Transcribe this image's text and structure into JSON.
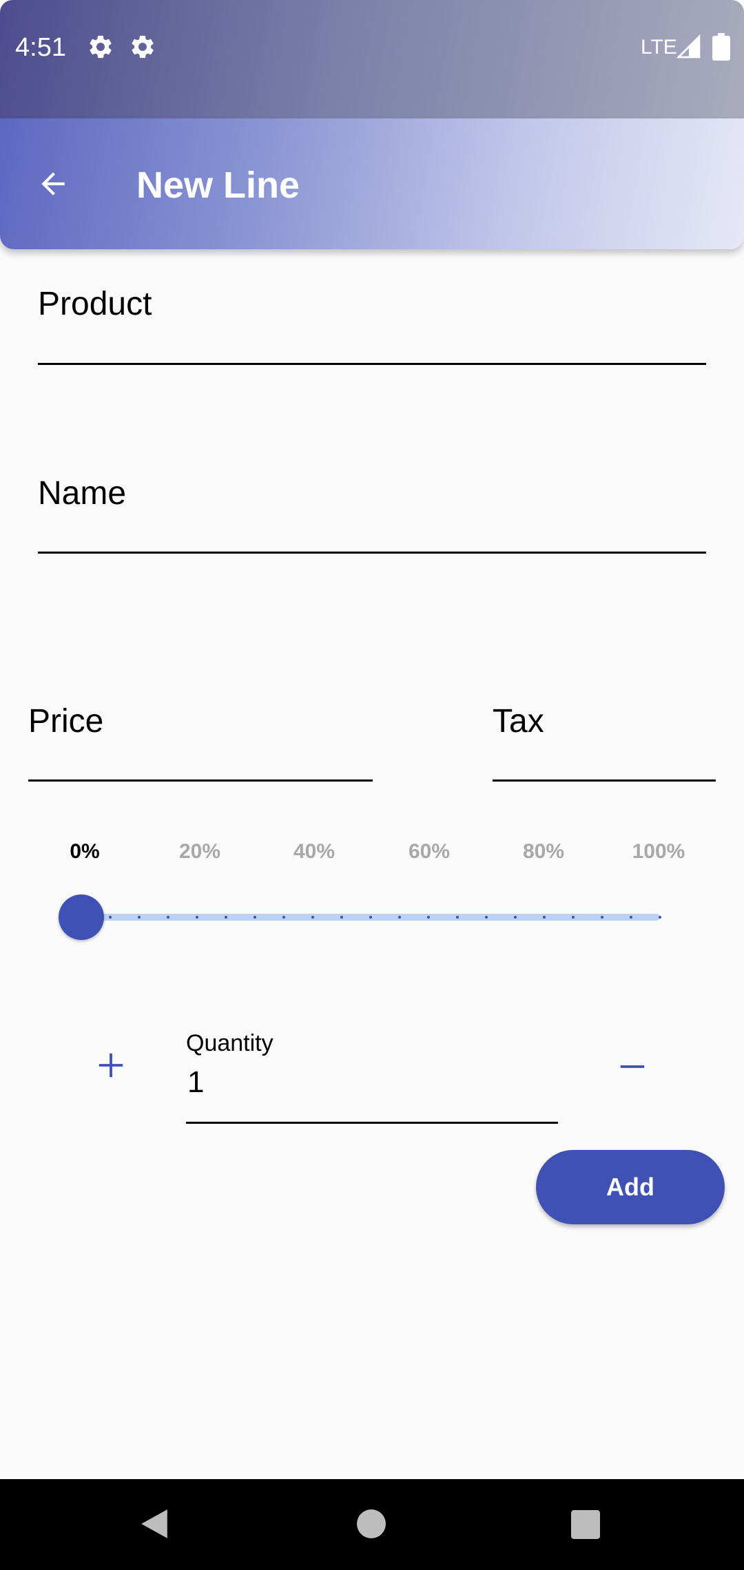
{
  "status_bar": {
    "time": "4:51",
    "network": "LTE",
    "icons": [
      "gear-icon",
      "gear-icon",
      "signal-icon",
      "battery-icon"
    ]
  },
  "app_bar": {
    "title": "New Line",
    "back_icon": "arrow-left-icon"
  },
  "form": {
    "product_label": "Product",
    "name_label": "Name",
    "price_label": "Price",
    "tax_label": "Tax"
  },
  "discount_slider": {
    "labels": [
      "0%",
      "20%",
      "40%",
      "60%",
      "80%",
      "100%"
    ],
    "selected_label": "0%",
    "value_fraction": 0,
    "steps": 20
  },
  "quantity": {
    "label": "Quantity",
    "value": "1",
    "increment_icon": "plus-icon",
    "decrement_icon": "minus-icon"
  },
  "add_button": {
    "label": "Add"
  },
  "navigation": {
    "icons": [
      "back-triangle-icon",
      "home-circle-icon",
      "recents-square-icon"
    ]
  },
  "colors": {
    "accent": "#3f51b5",
    "slider_track": "#bcd2f5"
  }
}
